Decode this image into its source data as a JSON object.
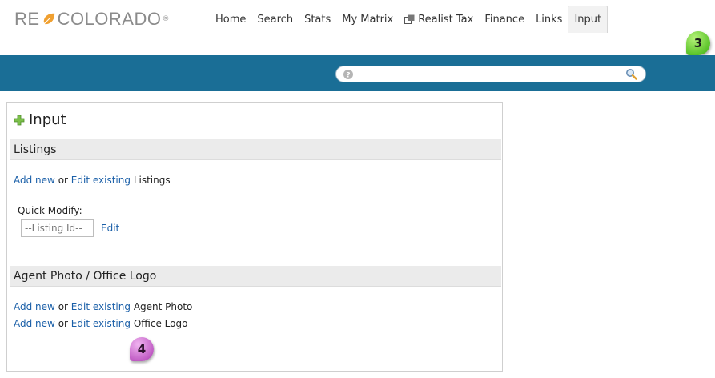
{
  "header": {
    "logo": {
      "left": "RE",
      "right": "COLORADO",
      "mark": "®"
    },
    "nav": [
      {
        "label": "Home"
      },
      {
        "label": "Search"
      },
      {
        "label": "Stats"
      },
      {
        "label": "My Matrix"
      },
      {
        "label": "Realist Tax",
        "icon": "external-window-icon"
      },
      {
        "label": "Finance"
      },
      {
        "label": "Links"
      },
      {
        "label": "Input",
        "active": true
      }
    ]
  },
  "search": {
    "placeholder": "",
    "value": ""
  },
  "annotations": {
    "step3": "3",
    "step4": "4"
  },
  "panel": {
    "title": "Input",
    "listings": {
      "heading": "Listings",
      "add_new": "Add new",
      "or": "or",
      "edit_existing": "Edit existing",
      "suffix": "Listings",
      "quick_modify_label": "Quick Modify:",
      "listing_id_placeholder": "--Listing Id--",
      "edit_label": "Edit"
    },
    "agent_photo": {
      "heading": "Agent Photo / Office Logo",
      "rows": [
        {
          "add_new": "Add new",
          "or": "or",
          "edit_existing": "Edit existing",
          "suffix": "Agent Photo"
        },
        {
          "add_new": "Add new",
          "or": "or",
          "edit_existing": "Edit existing",
          "suffix": "Office Logo"
        }
      ]
    }
  },
  "colors": {
    "band": "#1a6e96",
    "link": "#1a5fa8",
    "badge_green": "#5cc42a",
    "badge_pink": "#c25fc6",
    "logo_leaf": "#f0a030"
  }
}
